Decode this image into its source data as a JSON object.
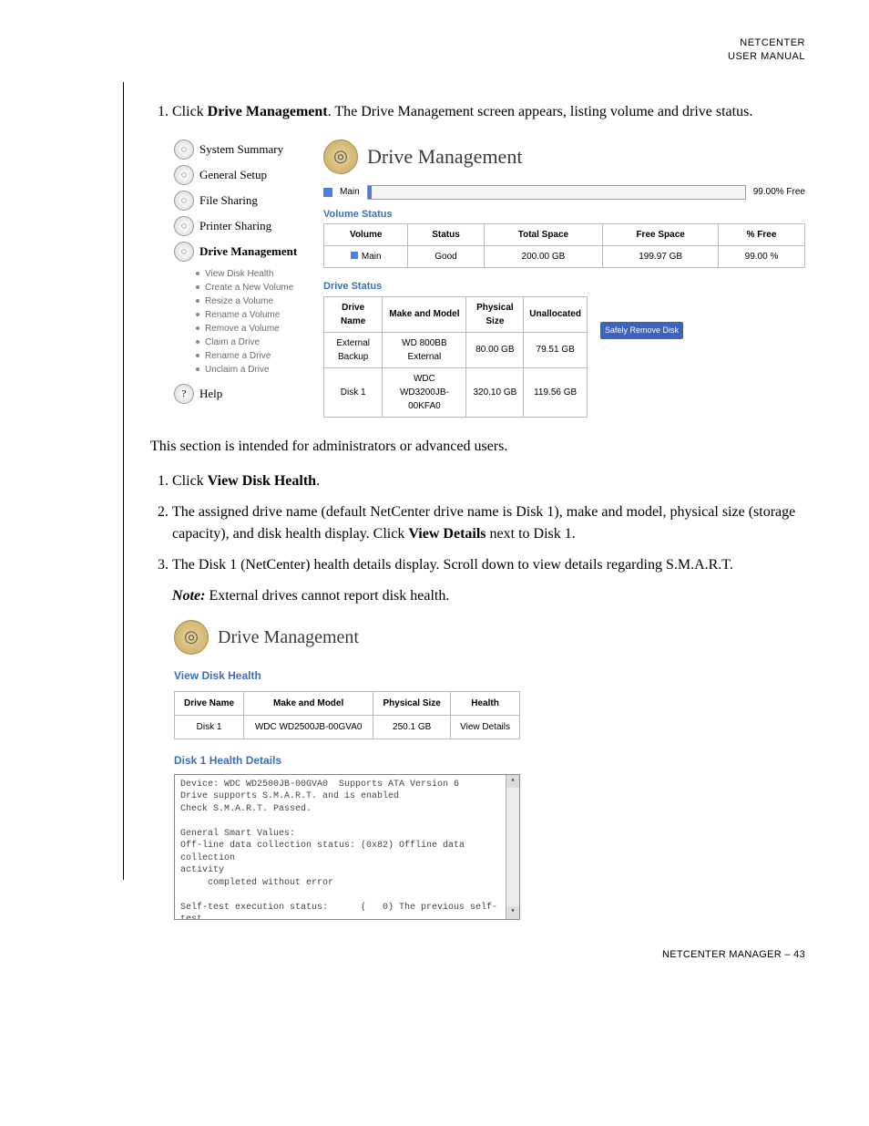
{
  "header": {
    "line1": "NETCENTER",
    "line2": "USER MANUAL"
  },
  "intro_list": {
    "item1_pre": "Click ",
    "item1_bold": "Drive Management",
    "item1_post": ". The Drive Management screen appears, listing volume and drive status."
  },
  "sshot1": {
    "nav": {
      "items": [
        "System Summary",
        "General Setup",
        "File Sharing",
        "Printer Sharing",
        "Drive Management"
      ],
      "sub": [
        "View Disk Health",
        "Create a New Volume",
        "Resize a Volume",
        "Rename a Volume",
        "Remove a Volume",
        "Claim a Drive",
        "Rename a Drive",
        "Unclaim a Drive"
      ],
      "help": "Help"
    },
    "title": "Drive Management",
    "free_main_label": "Main",
    "free_pct_label": "99.00% Free",
    "vol_section": "Volume Status",
    "vol_headers": [
      "Volume",
      "Status",
      "Total Space",
      "Free Space",
      "% Free"
    ],
    "vol_row": [
      "Main",
      "Good",
      "200.00 GB",
      "199.97 GB",
      "99.00 %"
    ],
    "drv_section": "Drive Status",
    "drv_headers": [
      "Drive Name",
      "Make and Model",
      "Physical Size",
      "Unallocated"
    ],
    "drv_rows": [
      [
        "External Backup",
        "WD 800BB External",
        "80.00 GB",
        "79.51 GB"
      ],
      [
        "Disk 1",
        "WDC WD3200JB-00KFA0",
        "320.10 GB",
        "119.56 GB"
      ]
    ],
    "remove_btn": "Safely Remove Disk"
  },
  "mid_para": "This section is intended for administrators or advanced users.",
  "steps": {
    "s1_pre": "Click ",
    "s1_bold": "View Disk Health",
    "s1_post": ".",
    "s2_pre": "The assigned drive name (default NetCenter drive name is Disk 1), make and model, physical size (storage capacity), and disk health display. Click ",
    "s2_bold": "View Details",
    "s2_post": " next to Disk 1.",
    "s3": "The Disk 1 (NetCenter) health details display. Scroll down to view details regarding S.M.A.R.T."
  },
  "note_bold": "Note:",
  "note_rest": " External drives cannot report disk health.",
  "sshot2": {
    "title": "Drive Management",
    "vdh": "View Disk Health",
    "headers": [
      "Drive Name",
      "Make and Model",
      "Physical Size",
      "Health"
    ],
    "row": [
      "Disk 1",
      "WDC WD2500JB-00GVA0",
      "250.1 GB",
      "View Details"
    ],
    "details_label": "Disk 1  Health Details",
    "details_text": "Device: WDC WD2500JB-00GVA0  Supports ATA Version 6\nDrive supports S.M.A.R.T. and is enabled\nCheck S.M.A.R.T. Passed.\n\nGeneral Smart Values:\nOff-line data collection status: (0x82) Offline data collection\nactivity\n     completed without error\n\nSelf-test execution status:      (   0) The previous self-test\nroutine completed\n     without error or no self-test has ever\n     been run\n\nTotal time to complete off-line"
  },
  "footer": "NETCENTER MANAGER – 43"
}
